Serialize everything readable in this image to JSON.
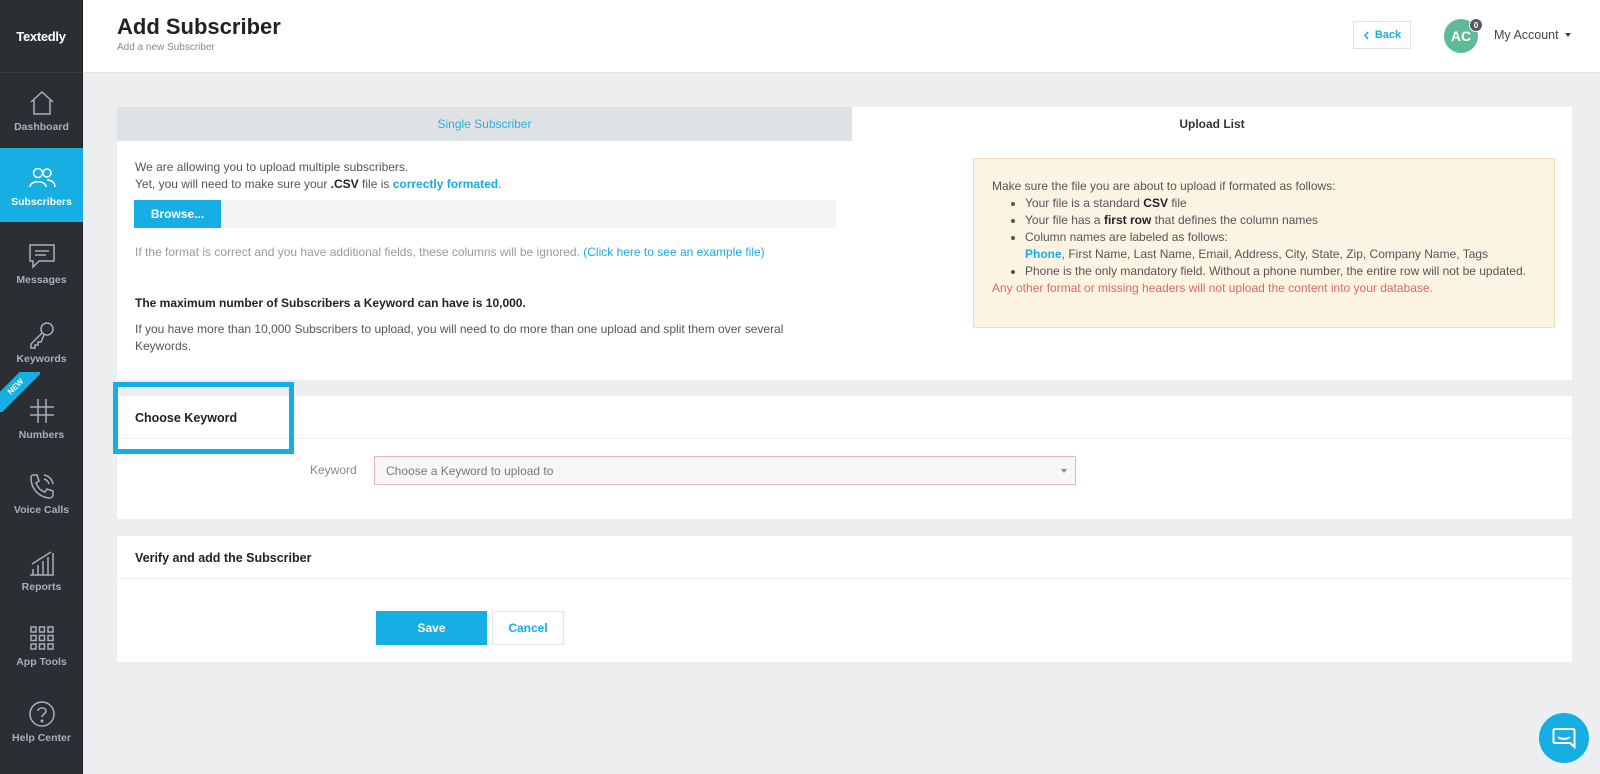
{
  "brand": {
    "logo_text": "Textedly",
    "accent": "#16aee3"
  },
  "sidebar": {
    "items": [
      {
        "label": "Dashboard",
        "icon": "home-icon"
      },
      {
        "label": "Subscribers",
        "icon": "users-icon",
        "active": true
      },
      {
        "label": "Messages",
        "icon": "message-icon"
      },
      {
        "label": "Keywords",
        "icon": "key-icon"
      },
      {
        "label": "Numbers",
        "icon": "hash-icon",
        "badge": "NEW"
      },
      {
        "label": "Voice Calls",
        "icon": "phone-icon"
      },
      {
        "label": "Reports",
        "icon": "chart-icon"
      },
      {
        "label": "App Tools",
        "icon": "grid-icon"
      },
      {
        "label": "Help Center",
        "icon": "help-icon"
      }
    ]
  },
  "header": {
    "title": "Add Subscriber",
    "subtitle": "Add a new Subscriber",
    "back_label": "Back",
    "avatar_initials": "AC",
    "avatar_badge": "0",
    "account_label": "My Account"
  },
  "upload": {
    "tabs": {
      "single": "Single Subscriber",
      "upload": "Upload List"
    },
    "intro_line1": "We are allowing you to upload multiple subscribers.",
    "intro_line2_pre": "Yet, you will need to make sure your ",
    "intro_csv": ".CSV",
    "intro_line2_mid": " file is ",
    "intro_link": "correctly formated",
    "intro_end": ".",
    "browse_label": "Browse...",
    "ignored_text": "If the format is correct and you have additional fields, these columns will be ignored. ",
    "example_link": "(Click here to see an example file)",
    "max_note": "The maximum number of Subscribers a Keyword can have is 10,000.",
    "split_note": "If you have more than 10,000 Subscribers to upload, you will need to do more than one upload and split them over several Keywords."
  },
  "info": {
    "intro": "Make sure the file you are about to upload if formated as follows:",
    "b1_pre": "Your file is a standard ",
    "b1_bold": "CSV",
    "b1_post": " file",
    "b2_pre": "Your file has a ",
    "b2_bold": "first row",
    "b2_post": " that defines the column names",
    "b3_text": "Column names are labeled as follows:",
    "b3_phone": "Phone",
    "b3_rest": ", First Name, Last Name, Email, Address, City, State, Zip, Company Name, Tags",
    "b4_text": "Phone is the only mandatory field. Without a phone number, the entire row will not be updated.",
    "warning": "Any other format or missing headers will not upload the content into your database."
  },
  "keyword": {
    "section_title": "Choose Keyword",
    "label": "Keyword",
    "placeholder": "Choose a Keyword to upload to"
  },
  "verify": {
    "section_title": "Verify and add the Subscriber",
    "save_label": "Save",
    "cancel_label": "Cancel"
  }
}
